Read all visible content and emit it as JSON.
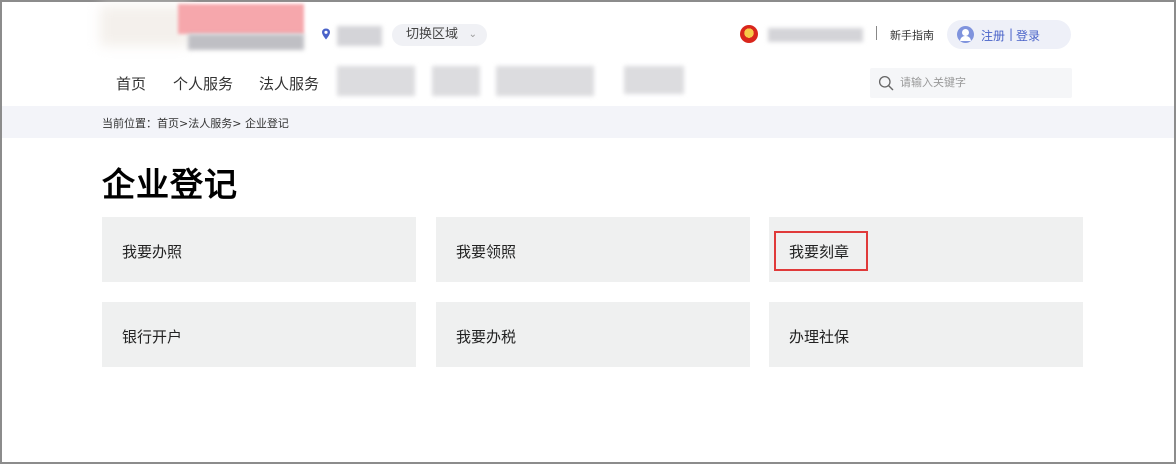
{
  "header": {
    "region_button": "切换区域",
    "region_chevron": "⌄",
    "guide_link": "新手指南",
    "register_link": "注册",
    "auth_separator": "|",
    "login_link": "登录",
    "nav": [
      "首页",
      "个人服务",
      "法人服务"
    ],
    "search_placeholder": "请输入关键字"
  },
  "breadcrumb": {
    "prefix": "当前位置：",
    "home": "首页",
    "sep1": ">",
    "level1": "法人服务",
    "sep2": ">",
    "current": "企业登记"
  },
  "page_title": "企业登记",
  "cards": [
    {
      "label": "我要办照",
      "highlighted": false
    },
    {
      "label": "我要领照",
      "highlighted": false
    },
    {
      "label": "我要刻章",
      "highlighted": true
    },
    {
      "label": "银行开户",
      "highlighted": false
    },
    {
      "label": "我要办税",
      "highlighted": false
    },
    {
      "label": "办理社保",
      "highlighted": false
    }
  ],
  "colors": {
    "accent": "#4a63c9",
    "highlight_border": "#e03a3a",
    "card_bg": "#eff0f0",
    "breadcrumb_bg": "#f3f4f9"
  }
}
